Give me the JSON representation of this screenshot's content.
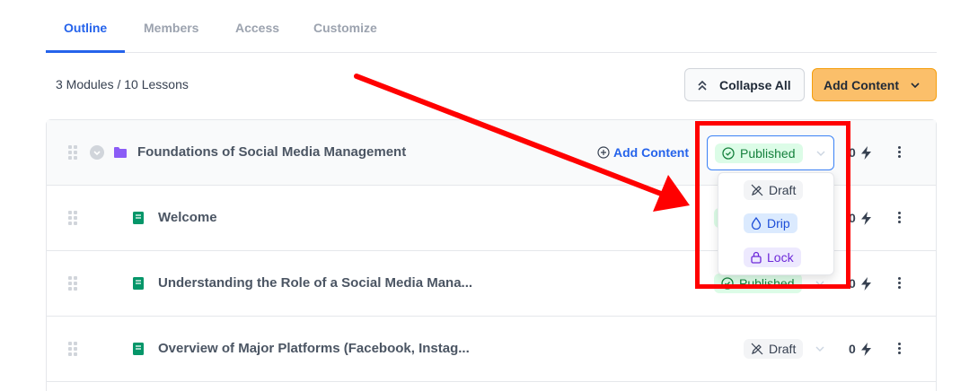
{
  "tabs": [
    "Outline",
    "Members",
    "Access",
    "Customize"
  ],
  "summary": "3 Modules / 10 Lessons",
  "toolbar": {
    "collapse_label": "Collapse All",
    "add_label": "Add Content"
  },
  "module": {
    "title": "Foundations of Social Media Management",
    "add_content_label": "Add Content",
    "status": "Published",
    "count": "0"
  },
  "lessons": [
    {
      "title": "Welcome",
      "count": "0"
    },
    {
      "title": "Understanding the Role of a Social Media Mana...",
      "status": "Published",
      "count": "0"
    },
    {
      "title": "Overview of Major Platforms (Facebook, Instag...",
      "status": "Draft",
      "count": "0"
    }
  ],
  "dropdown": {
    "options": [
      "Draft",
      "Drip",
      "Lock"
    ]
  },
  "colors": {
    "accent": "#2563eb",
    "annotation": "#ff0000",
    "add_button": "#fbbf6a"
  }
}
